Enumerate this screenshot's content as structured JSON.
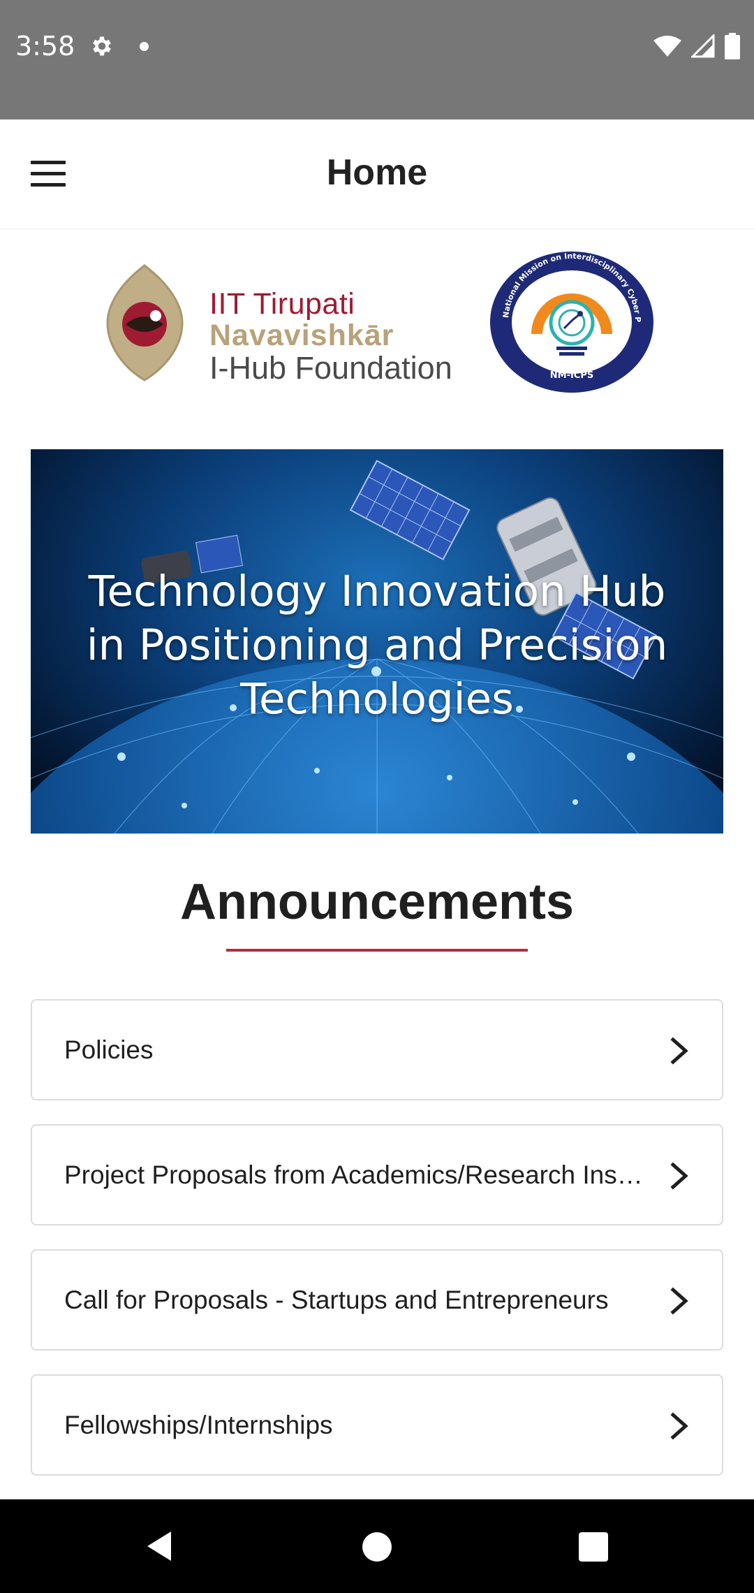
{
  "status_bar": {
    "time": "3:58",
    "icons": [
      "settings-icon",
      "notification-dot-icon",
      "wifi-icon",
      "signal-icon",
      "battery-icon"
    ]
  },
  "app_bar": {
    "title": "Home",
    "menu_icon": "hamburger-menu-icon"
  },
  "logos": {
    "iit": {
      "line1": "IIT Tirupati",
      "line2": "Navavishkār",
      "line3": "I-Hub Foundation"
    },
    "nmicps": {
      "ring_text": "National Mission on Interdisciplinary Cyber Physical Systems",
      "short_name": "NM-ICPS"
    }
  },
  "banner": {
    "lines": [
      "Technology Innovation Hub",
      "in Positioning and Precision",
      "Technologies"
    ]
  },
  "announcements": {
    "title": "Announcements",
    "items": [
      {
        "label": "Policies"
      },
      {
        "label": "Project Proposals from Academics/Research Institutions"
      },
      {
        "label": "Call for Proposals - Startups and Entrepreneurs"
      },
      {
        "label": "Fellowships/Internships"
      }
    ]
  },
  "colors": {
    "accent": "#c0283a",
    "iit_maroon": "#9e1b32",
    "iit_gold": "#b8a27a",
    "status_bar": "#777777",
    "nmicps_blue": "#1e2a78",
    "nmicps_orange": "#f08a1c"
  },
  "nav_bar": {
    "buttons": [
      "back-icon",
      "home-icon",
      "recents-icon"
    ]
  }
}
